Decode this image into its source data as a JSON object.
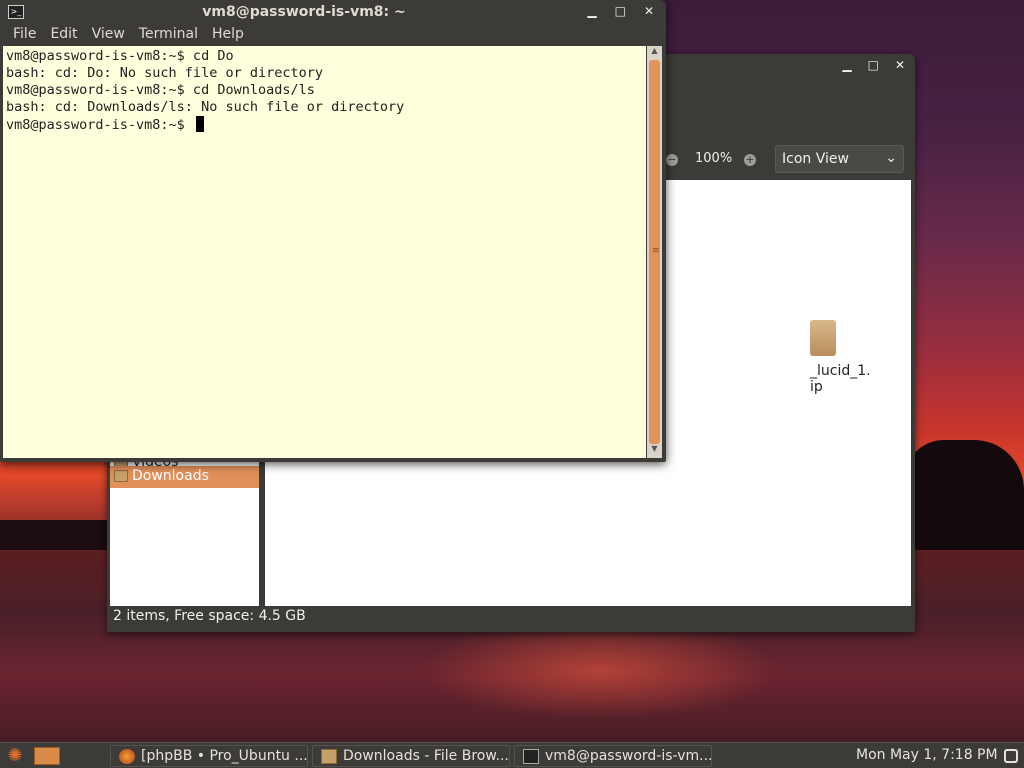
{
  "terminal": {
    "title": "vm8@password-is-vm8: ~",
    "menu": [
      "File",
      "Edit",
      "View",
      "Terminal",
      "Help"
    ],
    "lines": [
      "vm8@password-is-vm8:~$ cd Do",
      "bash: cd: Do: No such file or directory",
      "vm8@password-is-vm8:~$ cd Downloads/ls",
      "bash: cd: Downloads/ls: No such file or directory",
      "vm8@password-is-vm8:~$ "
    ],
    "controls": {
      "minimize": "▁",
      "maximize": "□",
      "close": "✕"
    }
  },
  "file_browser": {
    "zoom": "100%",
    "view_mode": "Icon View",
    "visible_file_name_line1": "_lucid_1.",
    "visible_file_name_line2": "ip",
    "sidebar_items": [
      {
        "label": "Videos",
        "selected": false
      },
      {
        "label": "Downloads",
        "selected": true
      }
    ],
    "status": "2 items, Free space: 4.5 GB",
    "controls": {
      "minimize": "▁",
      "maximize": "□",
      "close": "✕"
    }
  },
  "panel": {
    "tasks": [
      {
        "label": "[phpBB • Pro_Ubuntu ...",
        "icon": "firefox-icon"
      },
      {
        "label": "Downloads - File Brow...",
        "icon": "folder-icon"
      },
      {
        "label": "vm8@password-is-vm...",
        "icon": "terminal-icon"
      }
    ],
    "clock": "Mon May  1,  7:18 PM"
  },
  "colors": {
    "terminal_bg": "#ffffdd",
    "accent_orange": "#e2905a",
    "window_frame": "#3c3b37"
  }
}
